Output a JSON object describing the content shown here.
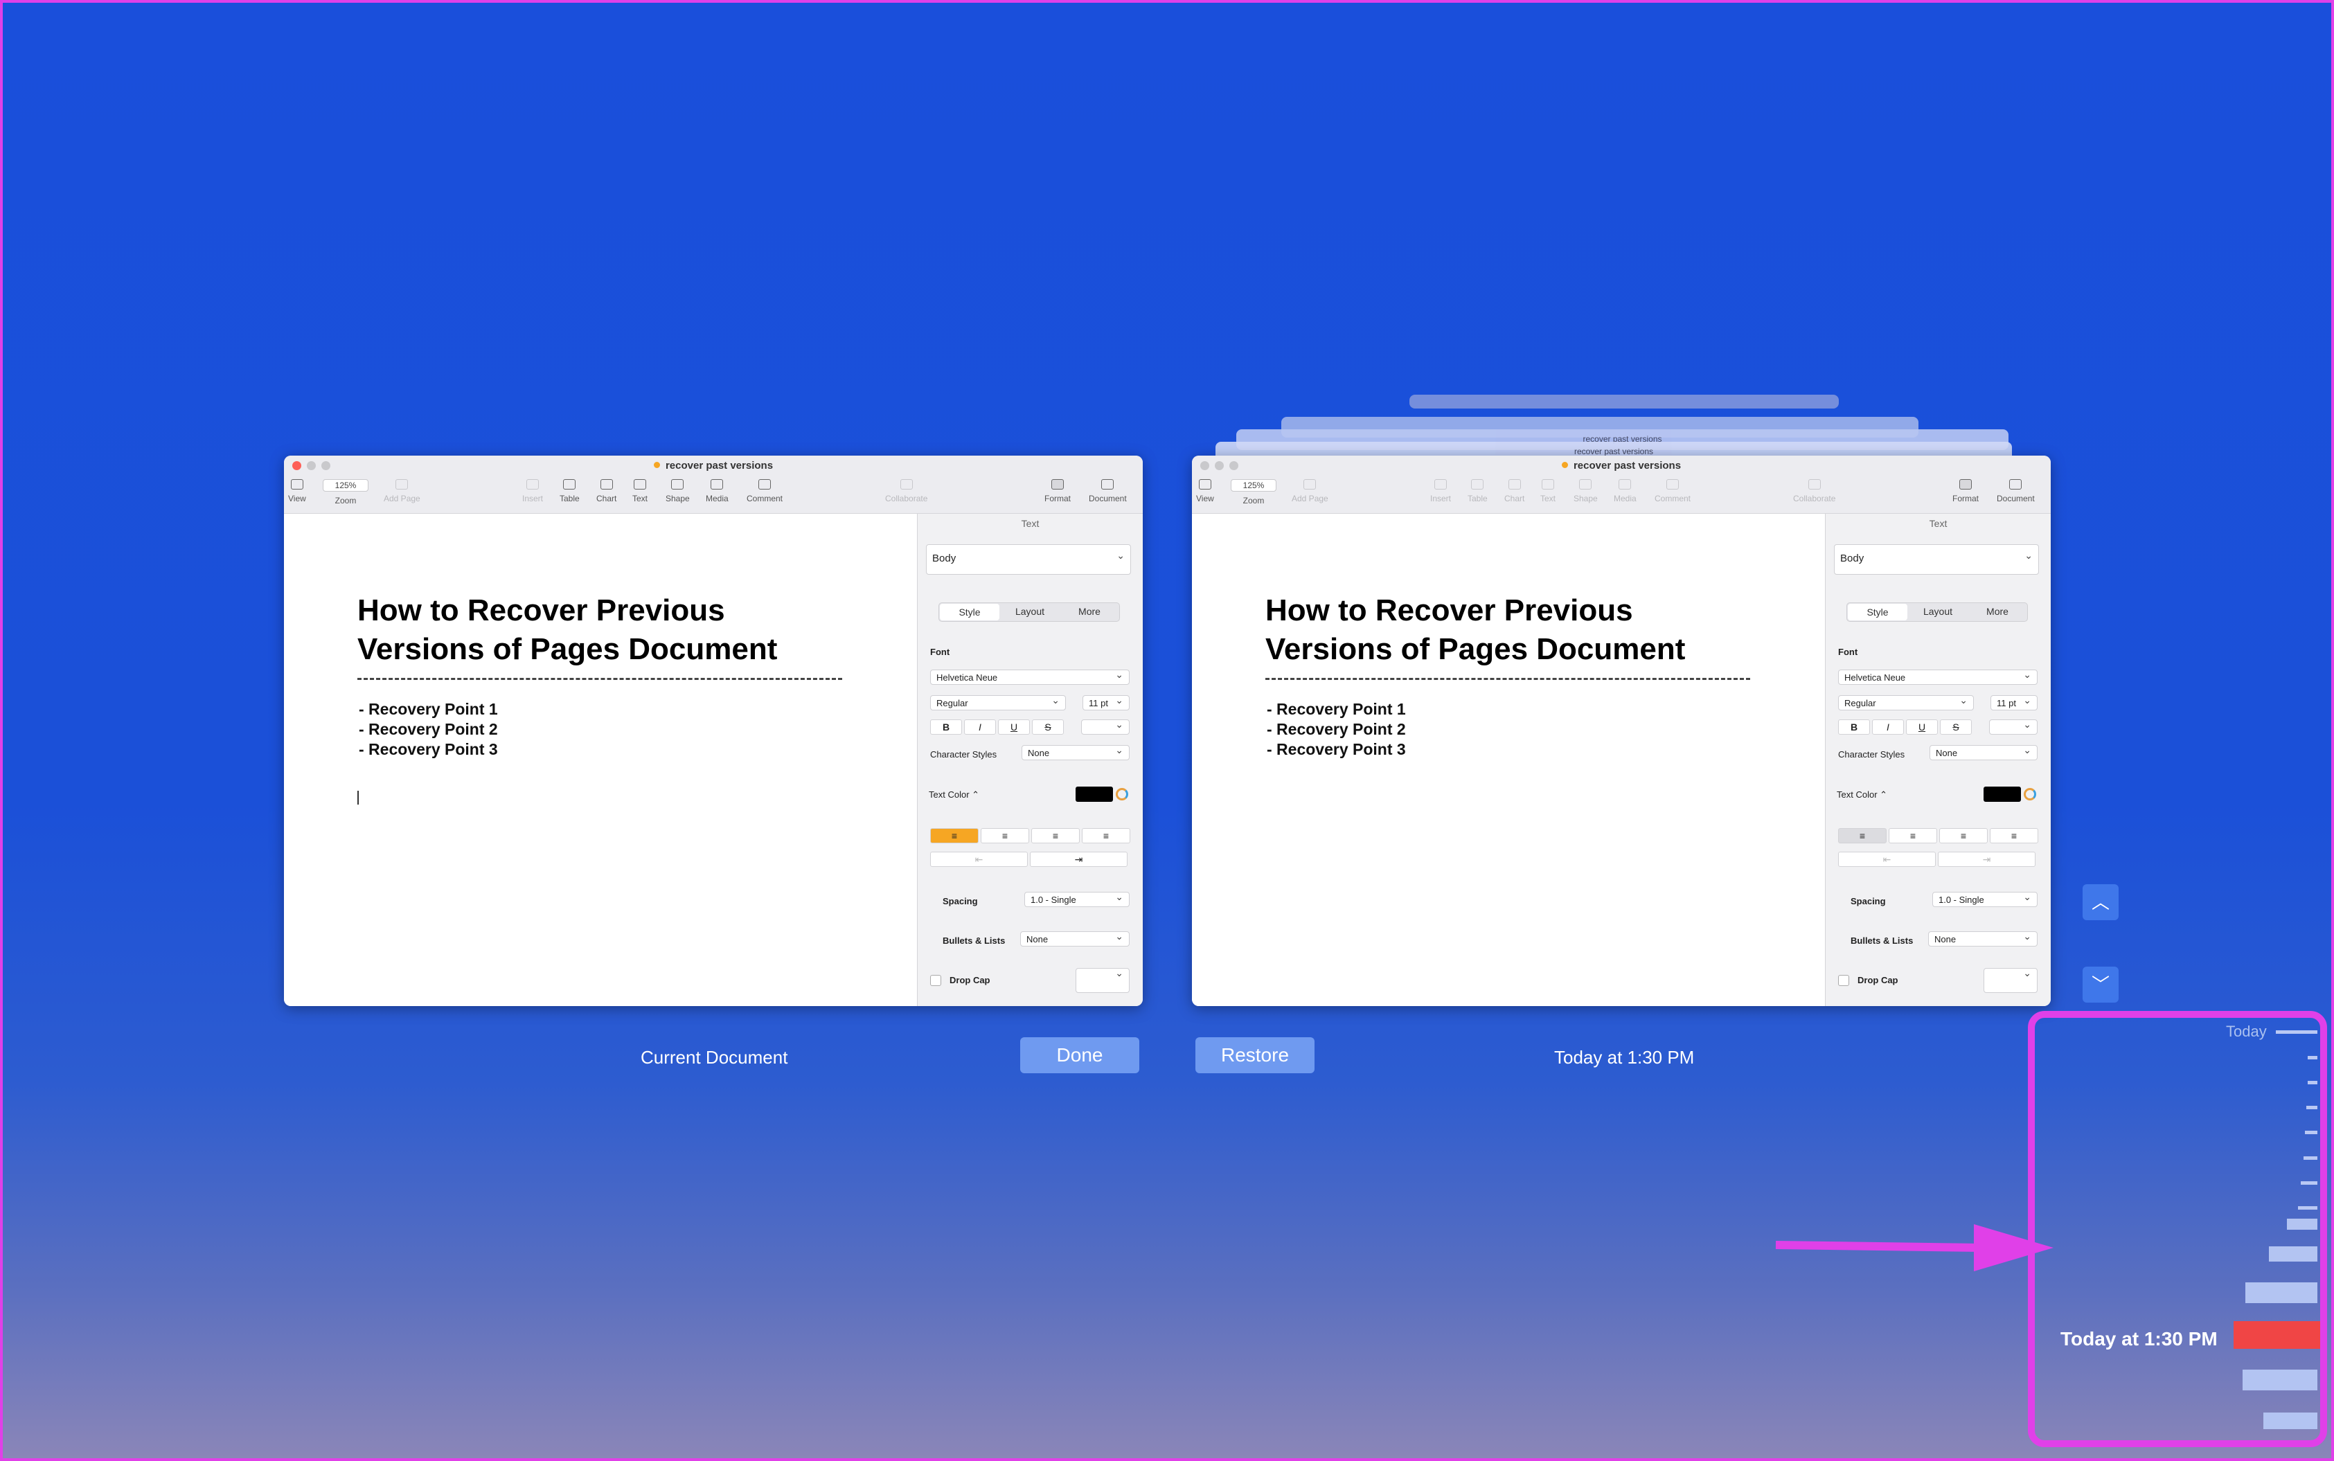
{
  "window_title": "recover past versions",
  "stack_titles": [
    "recover past versions",
    "recover past versions"
  ],
  "toolbar": {
    "view": "View",
    "zoom_value": "125%",
    "zoom": "Zoom",
    "add_page": "Add Page",
    "insert": "Insert",
    "table": "Table",
    "chart": "Chart",
    "text": "Text",
    "shape": "Shape",
    "media": "Media",
    "comment": "Comment",
    "collaborate": "Collaborate",
    "format": "Format",
    "document": "Document"
  },
  "document": {
    "heading_line1": "How to Recover Previous",
    "heading_line2": "Versions of Pages Document",
    "items": [
      "-  Recovery Point 1",
      "-  Recovery Point 2",
      "-  Recovery Point 3"
    ]
  },
  "sidebar": {
    "section": "Text",
    "style": "Body",
    "tabs": [
      "Style",
      "Layout",
      "More"
    ],
    "font_label": "Font",
    "font_name": "Helvetica Neue",
    "font_weight": "Regular",
    "font_size": "11 pt",
    "format_buttons": [
      "B",
      "I",
      "U",
      "S"
    ],
    "char_styles_label": "Character Styles",
    "char_styles_value": "None",
    "text_color_label": "Text Color ⌃",
    "spacing_label": "Spacing",
    "spacing_value": "1.0 - Single",
    "bullets_label": "Bullets & Lists",
    "bullets_value": "None",
    "drop_cap_label": "Drop Cap"
  },
  "captions": {
    "left": "Current Document",
    "right": "Today at 1:30 PM"
  },
  "buttons": {
    "done": "Done",
    "restore": "Restore"
  },
  "timeline": {
    "top_label": "Today",
    "current_label": "Today at 1:30 PM"
  },
  "colors": {
    "accent": "#f6a623",
    "highlight": "#e040e8",
    "selected_version": "#f04545"
  }
}
